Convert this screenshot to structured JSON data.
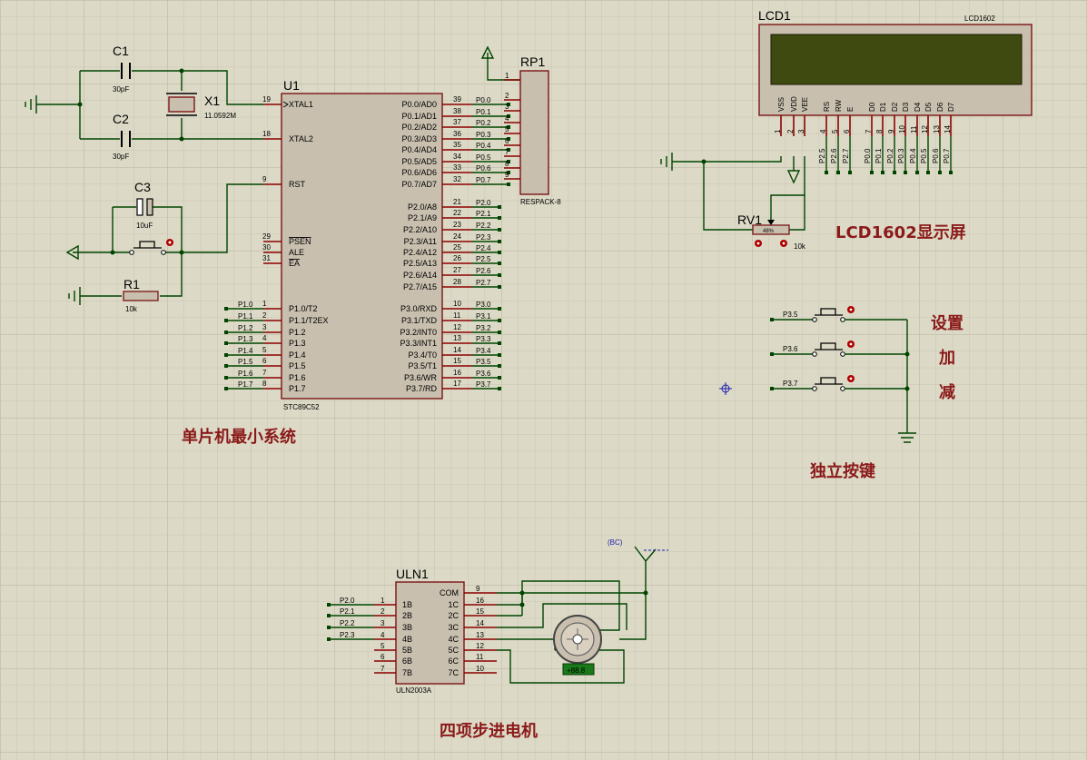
{
  "title": "单片机最小系统",
  "labels": {
    "mcu_system": "单片机最小系统",
    "lcd_screen": "LCD1602显示屏",
    "buttons": "独立按键",
    "stepper": "四项步进电机",
    "btn_set": "设置",
    "btn_add": "加",
    "btn_sub": "减"
  },
  "u1": {
    "ref": "U1",
    "part": "STC89C52",
    "left_pins": [
      {
        "num": "19",
        "name": "XTAL1"
      },
      {
        "num": "18",
        "name": "XTAL2"
      },
      {
        "num": "9",
        "name": "RST"
      },
      {
        "num": "29",
        "name": "PSEN"
      },
      {
        "num": "30",
        "name": "ALE"
      },
      {
        "num": "31",
        "name": "EA"
      },
      {
        "num": "1",
        "name": "P1.0/T2"
      },
      {
        "num": "2",
        "name": "P1.1/T2EX"
      },
      {
        "num": "3",
        "name": "P1.2"
      },
      {
        "num": "4",
        "name": "P1.3"
      },
      {
        "num": "5",
        "name": "P1.4"
      },
      {
        "num": "6",
        "name": "P1.5"
      },
      {
        "num": "7",
        "name": "P1.6"
      },
      {
        "num": "8",
        "name": "P1.7"
      }
    ],
    "p1_nets": [
      "P1.0",
      "P1.1",
      "P1.2",
      "P1.3",
      "P1.4",
      "P1.5",
      "P1.6",
      "P1.7"
    ],
    "p0_pins": [
      {
        "num": "39",
        "name": "P0.0/AD0",
        "net": "P0.0"
      },
      {
        "num": "38",
        "name": "P0.1/AD1",
        "net": "P0.1"
      },
      {
        "num": "37",
        "name": "P0.2/AD2",
        "net": "P0.2"
      },
      {
        "num": "36",
        "name": "P0.3/AD3",
        "net": "P0.3"
      },
      {
        "num": "35",
        "name": "P0.4/AD4",
        "net": "P0.4"
      },
      {
        "num": "34",
        "name": "P0.5/AD5",
        "net": "P0.5"
      },
      {
        "num": "33",
        "name": "P0.6/AD6",
        "net": "P0.6"
      },
      {
        "num": "32",
        "name": "P0.7/AD7",
        "net": "P0.7"
      }
    ],
    "p2_pins": [
      {
        "num": "21",
        "name": "P2.0/A8",
        "net": "P2.0"
      },
      {
        "num": "22",
        "name": "P2.1/A9",
        "net": "P2.1"
      },
      {
        "num": "23",
        "name": "P2.2/A10",
        "net": "P2.2"
      },
      {
        "num": "24",
        "name": "P2.3/A11",
        "net": "P2.3"
      },
      {
        "num": "25",
        "name": "P2.4/A12",
        "net": "P2.4"
      },
      {
        "num": "26",
        "name": "P2.5/A13",
        "net": "P2.5"
      },
      {
        "num": "27",
        "name": "P2.6/A14",
        "net": "P2.6"
      },
      {
        "num": "28",
        "name": "P2.7/A15",
        "net": "P2.7"
      }
    ],
    "p3_pins": [
      {
        "num": "10",
        "name": "P3.0/RXD",
        "net": "P3.0"
      },
      {
        "num": "11",
        "name": "P3.1/TXD",
        "net": "P3.1"
      },
      {
        "num": "12",
        "name": "P3.2/INT0",
        "net": "P3.2"
      },
      {
        "num": "13",
        "name": "P3.3/INT1",
        "net": "P3.3"
      },
      {
        "num": "14",
        "name": "P3.4/T0",
        "net": "P3.4"
      },
      {
        "num": "15",
        "name": "P3.5/T1",
        "net": "P3.5"
      },
      {
        "num": "16",
        "name": "P3.6/WR",
        "net": "P3.6"
      },
      {
        "num": "17",
        "name": "P3.7/RD",
        "net": "P3.7"
      }
    ]
  },
  "rp1": {
    "ref": "RP1",
    "part": "RESPACK-8",
    "pins": [
      "1",
      "2",
      "3",
      "4",
      "5",
      "6",
      "7",
      "8",
      "9"
    ]
  },
  "c1": {
    "ref": "C1",
    "value": "30pF"
  },
  "c2": {
    "ref": "C2",
    "value": "30pF"
  },
  "c3": {
    "ref": "C3",
    "value": "10uF"
  },
  "x1": {
    "ref": "X1",
    "value": "11.0592M"
  },
  "r1": {
    "ref": "R1",
    "value": "10k"
  },
  "lcd1": {
    "ref": "LCD1",
    "part": "LCD1602",
    "screen_color": "#3f4a10",
    "pins": [
      {
        "name": "VSS",
        "num": "1"
      },
      {
        "name": "VDD",
        "num": "2"
      },
      {
        "name": "VEE",
        "num": "3"
      },
      {
        "name": "RS",
        "num": "4"
      },
      {
        "name": "RW",
        "num": "5"
      },
      {
        "name": "E",
        "num": "6"
      },
      {
        "name": "D0",
        "num": "7"
      },
      {
        "name": "D1",
        "num": "8"
      },
      {
        "name": "D2",
        "num": "9"
      },
      {
        "name": "D3",
        "num": "10"
      },
      {
        "name": "D4",
        "num": "11"
      },
      {
        "name": "D5",
        "num": "12"
      },
      {
        "name": "D6",
        "num": "13"
      },
      {
        "name": "D7",
        "num": "14"
      }
    ],
    "nets": [
      "P2.5",
      "P2.6",
      "P2.7",
      "P0.0",
      "P0.1",
      "P0.2",
      "P0.3",
      "P0.4",
      "P0.5",
      "P0.6",
      "P0.7"
    ]
  },
  "rv1": {
    "ref": "RV1",
    "value": "10k",
    "percent": "48%"
  },
  "keys": [
    {
      "net": "P3.5"
    },
    {
      "net": "P3.6"
    },
    {
      "net": "P3.7"
    }
  ],
  "uln1": {
    "ref": "ULN1",
    "part": "ULN2003A",
    "in_pins": [
      {
        "num": "1",
        "name": "1B",
        "net": "P2.0"
      },
      {
        "num": "2",
        "name": "2B",
        "net": "P2.1"
      },
      {
        "num": "3",
        "name": "3B",
        "net": "P2.2"
      },
      {
        "num": "4",
        "name": "4B",
        "net": "P2.3"
      },
      {
        "num": "5",
        "name": "5B",
        "net": ""
      },
      {
        "num": "6",
        "name": "6B",
        "net": ""
      },
      {
        "num": "7",
        "name": "7B",
        "net": ""
      }
    ],
    "out_pins": [
      {
        "num": "9",
        "name": "COM"
      },
      {
        "num": "16",
        "name": "1C"
      },
      {
        "num": "15",
        "name": "2C"
      },
      {
        "num": "14",
        "name": "3C"
      },
      {
        "num": "13",
        "name": "4C"
      },
      {
        "num": "12",
        "name": "5C"
      },
      {
        "num": "11",
        "name": "6C"
      },
      {
        "num": "10",
        "name": "7C"
      }
    ]
  },
  "motor": {
    "readout": "+88.8",
    "display_color": "#1a7a1a"
  },
  "power": {
    "label": "(BC)"
  },
  "colors": {
    "wire": "#004400",
    "pin": "#8b0000",
    "body": "#c8bfae",
    "text_cn": "#8b1a1a"
  }
}
